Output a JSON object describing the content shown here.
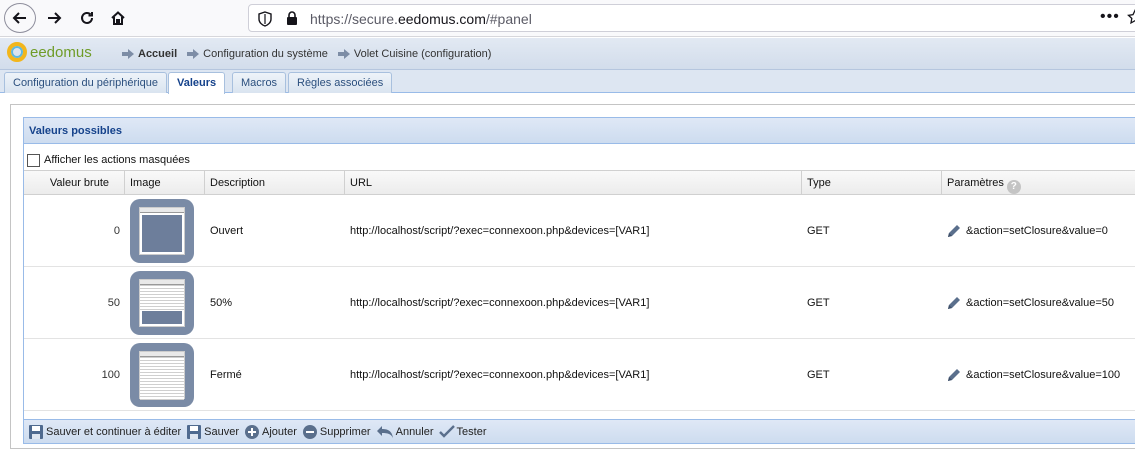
{
  "browser": {
    "url_prefix": "https://secure.",
    "url_domain": "eedomus.com",
    "url_suffix": "/#panel",
    "menu_glyph": "•••"
  },
  "app": {
    "logo_text": "eedomus",
    "breadcrumb": [
      "Accueil",
      "Configuration du système",
      "Volet Cuisine (configuration)"
    ]
  },
  "tabs": [
    {
      "label": "Configuration du périphérique",
      "active": false
    },
    {
      "label": "Valeurs",
      "active": true
    },
    {
      "label": "Macros",
      "active": false
    },
    {
      "label": "Règles associées",
      "active": false
    }
  ],
  "grid": {
    "title": "Valeurs possibles",
    "show_hidden_label": "Afficher les actions masquées",
    "show_hidden_checked": false,
    "columns": [
      "Valeur brute",
      "Image",
      "Description",
      "URL",
      "Type",
      "Paramètres"
    ],
    "help_glyph": "?",
    "rows": [
      {
        "raw": "0",
        "image": "shutter-open",
        "description": "Ouvert",
        "url": "http://localhost/script/?exec=connexoon.php&devices=[VAR1]",
        "type": "GET",
        "params": "&action=setClosure&value=0"
      },
      {
        "raw": "50",
        "image": "shutter-half",
        "description": "50%",
        "url": "http://localhost/script/?exec=connexoon.php&devices=[VAR1]",
        "type": "GET",
        "params": "&action=setClosure&value=50"
      },
      {
        "raw": "100",
        "image": "shutter-closed",
        "description": "Fermé",
        "url": "http://localhost/script/?exec=connexoon.php&devices=[VAR1]",
        "type": "GET",
        "params": "&action=setClosure&value=100"
      }
    ]
  },
  "toolbar": {
    "save_continue": "Sauver et continuer à éditer",
    "save": "Sauver",
    "add": "Ajouter",
    "delete": "Supprimer",
    "cancel": "Annuler",
    "test": "Tester"
  }
}
